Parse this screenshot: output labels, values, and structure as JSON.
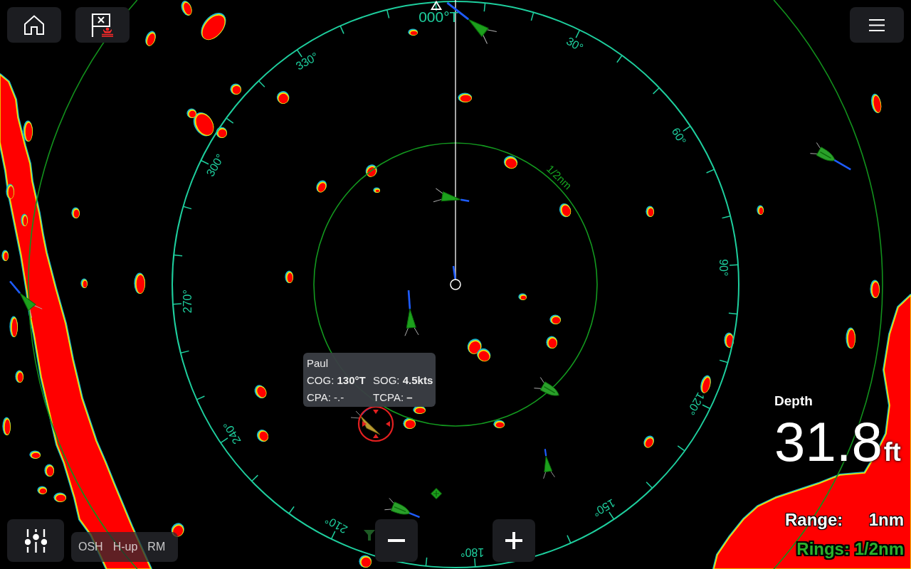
{
  "heading_label": "000°T",
  "bearing_labels": [
    "30°",
    "60°",
    "90°",
    "120°",
    "150°",
    "180°",
    "210°",
    "240°",
    "270°",
    "300°",
    "330°"
  ],
  "range_ring_label": "1/2nm",
  "target_popup": {
    "name": "Paul",
    "fields": [
      "COG: **130°T**",
      "SOG: **4.5kts**",
      "CPA: -.-",
      "TCPA: **–**"
    ]
  },
  "depth": {
    "label": "Depth",
    "value": "31.8",
    "unit": "ft"
  },
  "range": {
    "label": "Range:",
    "value": "1nm"
  },
  "rings": "Rings: 1/2nm",
  "mode_bar": [
    "OSH",
    "H-up",
    "RM"
  ]
}
